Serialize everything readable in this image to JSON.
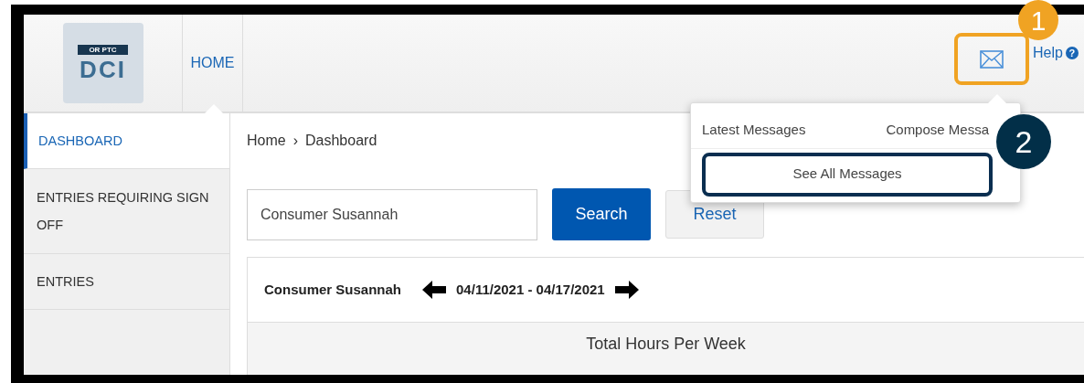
{
  "header": {
    "logo": {
      "caption": "OR PTC",
      "mark": "DCI"
    },
    "nav": [
      {
        "label": "HOME",
        "selected": true
      }
    ],
    "help": "Help",
    "help_icon": "?"
  },
  "callouts": [
    "1",
    "2"
  ],
  "messages_menu": {
    "latest": "Latest Messages",
    "compose": "Compose Messa",
    "see_all": "See All Messages"
  },
  "sidebar": {
    "items": [
      {
        "label": "DASHBOARD",
        "selected": true
      },
      {
        "label": "ENTRIES REQUIRING SIGN OFF",
        "selected": false
      },
      {
        "label": "ENTRIES",
        "selected": false
      }
    ]
  },
  "breadcrumb": [
    "Home",
    "Dashboard"
  ],
  "breadcrumb_separator": "›",
  "search": {
    "value": "Consumer Susannah",
    "button": "Search",
    "reset": "Reset"
  },
  "week": {
    "consumer": "Consumer Susannah",
    "range": "04/11/2021 - 04/17/2021"
  },
  "summary_title": "Total Hours Per Week"
}
